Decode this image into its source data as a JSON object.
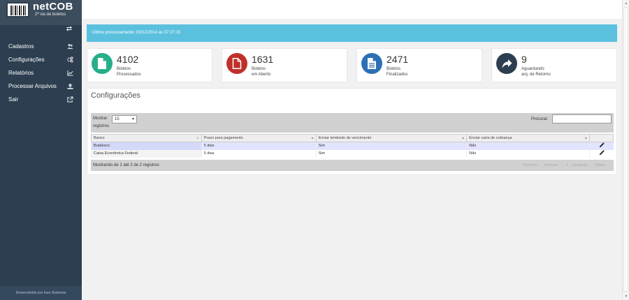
{
  "app": {
    "logo_title": "netCOB",
    "logo_subtitle": "2ª via de boletos",
    "footer": "Desenvolvido por Ineo Sistemas"
  },
  "sidebar": {
    "items": [
      {
        "label": "Cadastros",
        "icon": "users-icon"
      },
      {
        "label": "Configurações",
        "icon": "gears-icon"
      },
      {
        "label": "Relatórios",
        "icon": "line-chart-icon"
      },
      {
        "label": "Processar Arquivos",
        "icon": "upload-icon"
      },
      {
        "label": "Sair",
        "icon": "external-link-icon"
      }
    ]
  },
  "banner": {
    "text": "Último processamento: 03/12/2014 às 07:27:15",
    "color": "#5bc0de"
  },
  "stats": [
    {
      "value": "4102",
      "line1": "Boletos",
      "line2": "Processados",
      "color": "#27ae8a",
      "icon": "file-icon"
    },
    {
      "value": "1631",
      "line1": "Boletos",
      "line2": "em Aberto",
      "color": "#c0302b",
      "icon": "file-outline-icon"
    },
    {
      "value": "2471",
      "line1": "Boletos",
      "line2": "Finalizados",
      "color": "#2d6fb4",
      "icon": "file-text-icon"
    },
    {
      "value": "9",
      "line1": "Aguardando",
      "line2": "arq. de Retorno",
      "color": "#2c3e50",
      "icon": "share-arrow-icon"
    }
  ],
  "panel": {
    "title": "Configurações",
    "show_label": "Mostrar",
    "show_suffix": "registros",
    "page_size": "15",
    "search_label": "Procurar:",
    "search_value": "",
    "columns": [
      "Banco",
      "Prazo para pagamento",
      "Enviar lembrete de vencimento",
      "Enviar carta de cobrança"
    ],
    "rows": [
      [
        "Bradesco",
        "5 dias",
        "Sim",
        "Não"
      ],
      [
        "Caixa Econômica Federal",
        "5 dias",
        "Sim",
        "Não"
      ]
    ],
    "info": "Mostrando de 1 até 2 de 2 registros",
    "pagination": {
      "first": "Primeiro",
      "prev": "Anterior",
      "page": "1",
      "next": "Seguinte",
      "last": "Último"
    }
  }
}
